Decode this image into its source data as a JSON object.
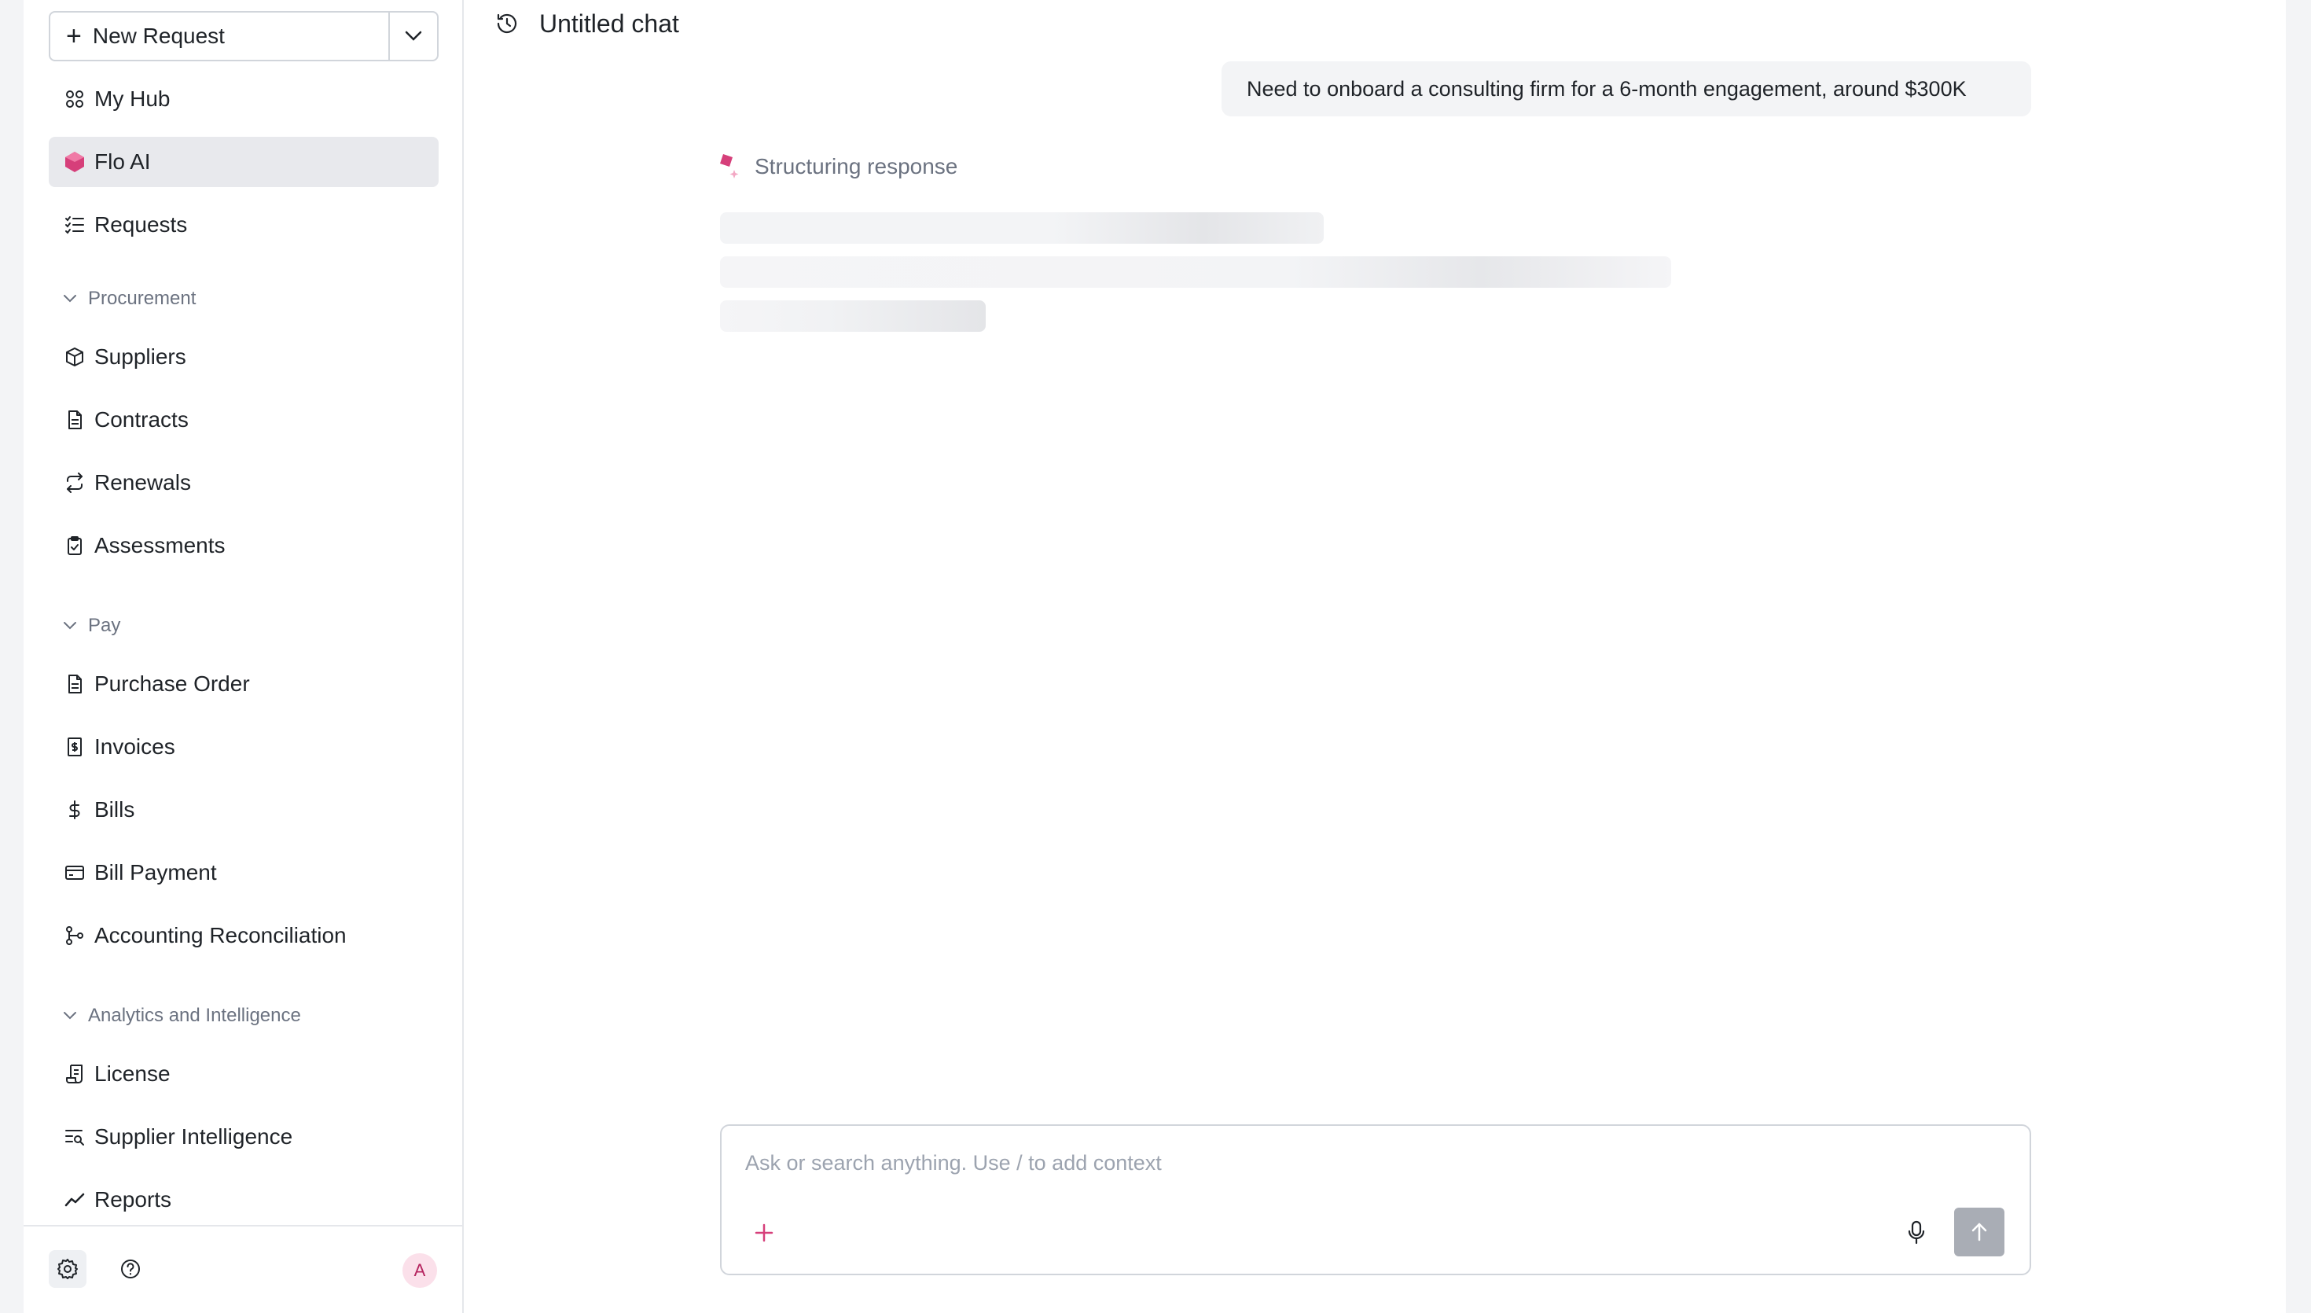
{
  "sidebar": {
    "new_request_label": "New Request",
    "items": {
      "my_hub": "My Hub",
      "flo_ai": "Flo AI",
      "requests": "Requests",
      "suppliers": "Suppliers",
      "contracts": "Contracts",
      "renewals": "Renewals",
      "assessments": "Assessments",
      "purchase_order": "Purchase Order",
      "invoices": "Invoices",
      "bills": "Bills",
      "bill_payment": "Bill Payment",
      "accounting_reconciliation": "Accounting Reconciliation",
      "license": "License",
      "supplier_intelligence": "Supplier Intelligence",
      "reports": "Reports"
    },
    "sections": {
      "procurement": "Procurement",
      "pay": "Pay",
      "analytics": "Analytics and Intelligence"
    },
    "avatar_initial": "A",
    "active_item": "Flo AI"
  },
  "chat": {
    "title": "Untitled chat",
    "user_message": "Need to onboard a consulting firm for a 6-month engagement, around $300K",
    "status_text": "Structuring response",
    "composer_placeholder": "Ask or search anything. Use / to add context"
  },
  "colors": {
    "accent": "#d63f7a",
    "active_bg": "#e8e9ed",
    "send_disabled": "#a9adb5"
  }
}
